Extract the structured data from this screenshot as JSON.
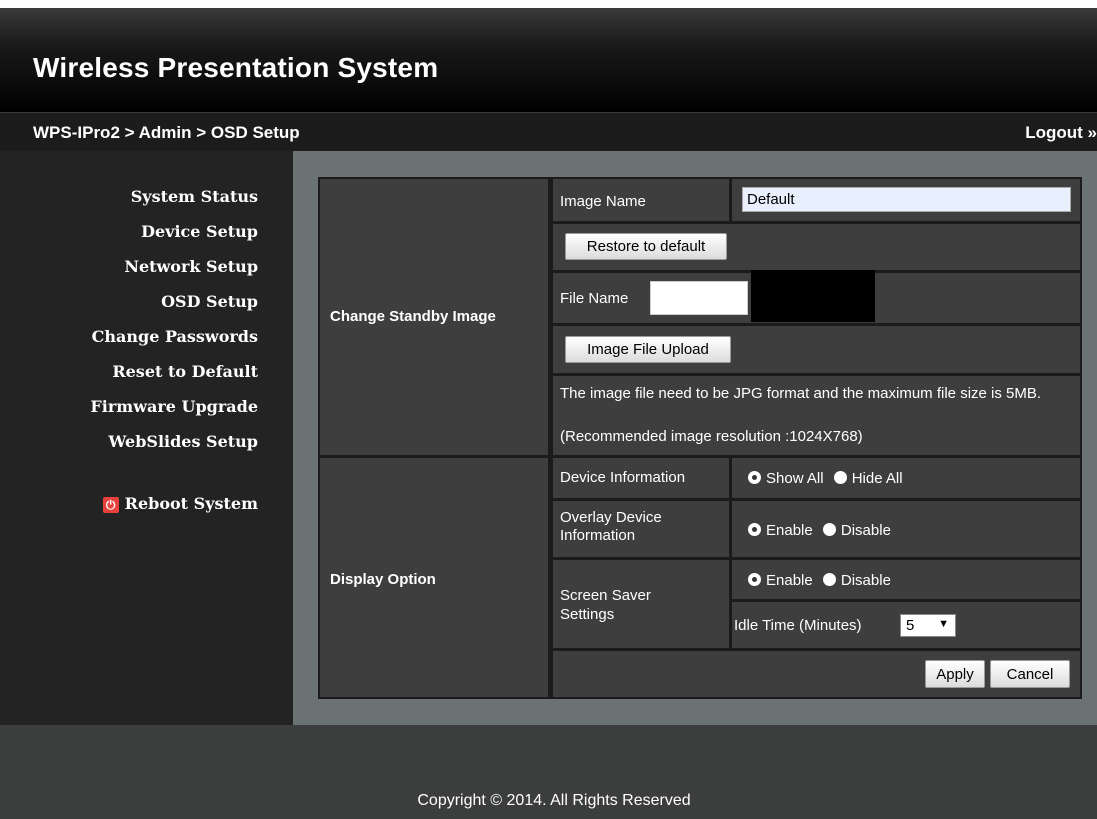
{
  "header": {
    "title": "Wireless Presentation System"
  },
  "breadcrumb": {
    "path": "WPS-IPro2 > Admin > OSD Setup",
    "logout": "Logout »"
  },
  "sidebar": {
    "items": [
      {
        "label": "System Status"
      },
      {
        "label": "Device Setup"
      },
      {
        "label": "Network Setup"
      },
      {
        "label": "OSD Setup"
      },
      {
        "label": "Change Passwords"
      },
      {
        "label": "Reset to Default"
      },
      {
        "label": "Firmware Upgrade"
      },
      {
        "label": "WebSlides Setup"
      }
    ],
    "reboot_label": "Reboot System",
    "reboot_icon": "power-icon"
  },
  "standby": {
    "section_label": "Change Standby Image",
    "image_name_label": "Image Name",
    "image_name_value": "Default",
    "restore_button": "Restore to default",
    "file_name_label": "File Name",
    "file_name_value": "",
    "upload_button": "Image File Upload",
    "note_line1": "The image file need to be JPG format and the maximum file size is 5MB.",
    "note_line2": "(Recommended image resolution :1024X768)"
  },
  "display": {
    "section_label": "Display Option",
    "device_info_label": "Device Information",
    "show_all": "Show All",
    "hide_all": "Hide All",
    "overlay_label": "Overlay Device Information",
    "enable": "Enable",
    "disable": "Disable",
    "screensaver_label": "Screen Saver Settings",
    "idle_label": "Idle Time (Minutes)",
    "idle_value": "5",
    "apply_button": "Apply",
    "cancel_button": "Cancel"
  },
  "footer": {
    "copyright": "Copyright © 2014. All Rights Reserved"
  }
}
